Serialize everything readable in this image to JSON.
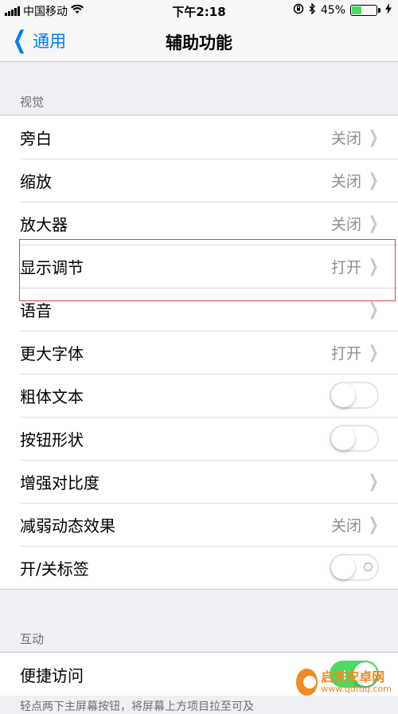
{
  "status_bar": {
    "carrier": "中国移动",
    "time": "下午2:18",
    "battery_percent": "45%",
    "battery_level": 0.45,
    "icons": [
      "signal-icon",
      "wifi-icon",
      "rotation-lock-icon",
      "bluetooth-icon",
      "battery-icon",
      "charging-icon"
    ]
  },
  "nav": {
    "back_label": "通用",
    "title": "辅助功能"
  },
  "sections": {
    "vision": {
      "header": "视觉",
      "rows": [
        {
          "label": "旁白",
          "value": "关闭"
        },
        {
          "label": "缩放",
          "value": "关闭"
        },
        {
          "label": "放大器",
          "value": "关闭"
        },
        {
          "label": "显示调节",
          "value": "打开"
        },
        {
          "label": "语音",
          "value": ""
        },
        {
          "label": "更大字体",
          "value": "打开"
        },
        {
          "label": "粗体文本",
          "toggle": false
        },
        {
          "label": "按钮形状",
          "toggle": false
        },
        {
          "label": "增强对比度",
          "value": ""
        },
        {
          "label": "减弱动态效果",
          "value": "关闭"
        },
        {
          "label": "开/关标签",
          "toggle": false
        }
      ]
    },
    "interaction": {
      "header": "互动",
      "rows": [
        {
          "label": "便捷访问",
          "toggle": true
        }
      ],
      "footer": "轻点两下主屏幕按钮，将屏幕上方项目拉至可及"
    }
  },
  "watermark": {
    "name": "启东安卓网",
    "url": "www.qdtdq.com"
  },
  "colors": {
    "accent": "#007aff",
    "toggle_on": "#4cd964",
    "highlight": "#d9474c",
    "watermark": "#f08a24"
  }
}
